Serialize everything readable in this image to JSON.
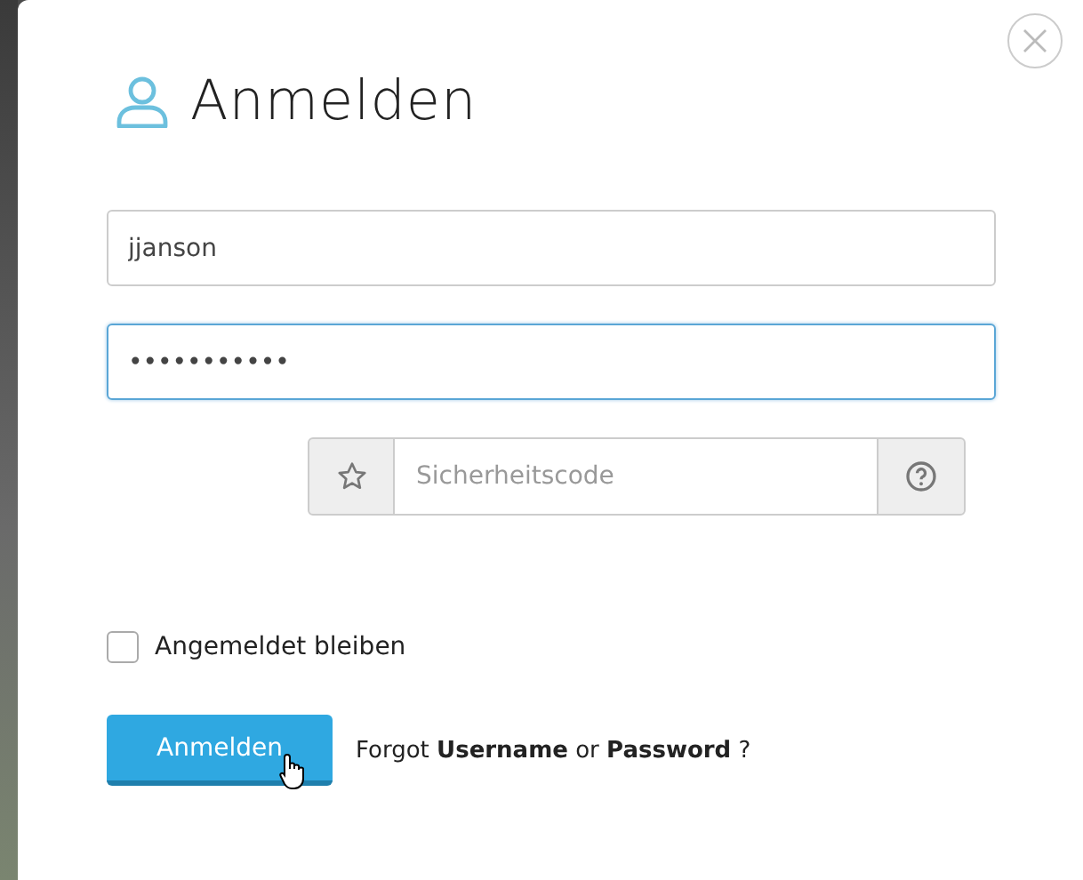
{
  "dialog": {
    "title": "Anmelden"
  },
  "username": {
    "value": "jjanson",
    "focused": false
  },
  "password": {
    "value": "•••••••••••",
    "focused": true
  },
  "security_code": {
    "placeholder": "Sicherheitscode"
  },
  "remember": {
    "label": "Angemeldet bleiben",
    "checked": false
  },
  "submit_button": "Anmelden",
  "forgot_text": "Forgot **Username** or **Password** ?"
}
